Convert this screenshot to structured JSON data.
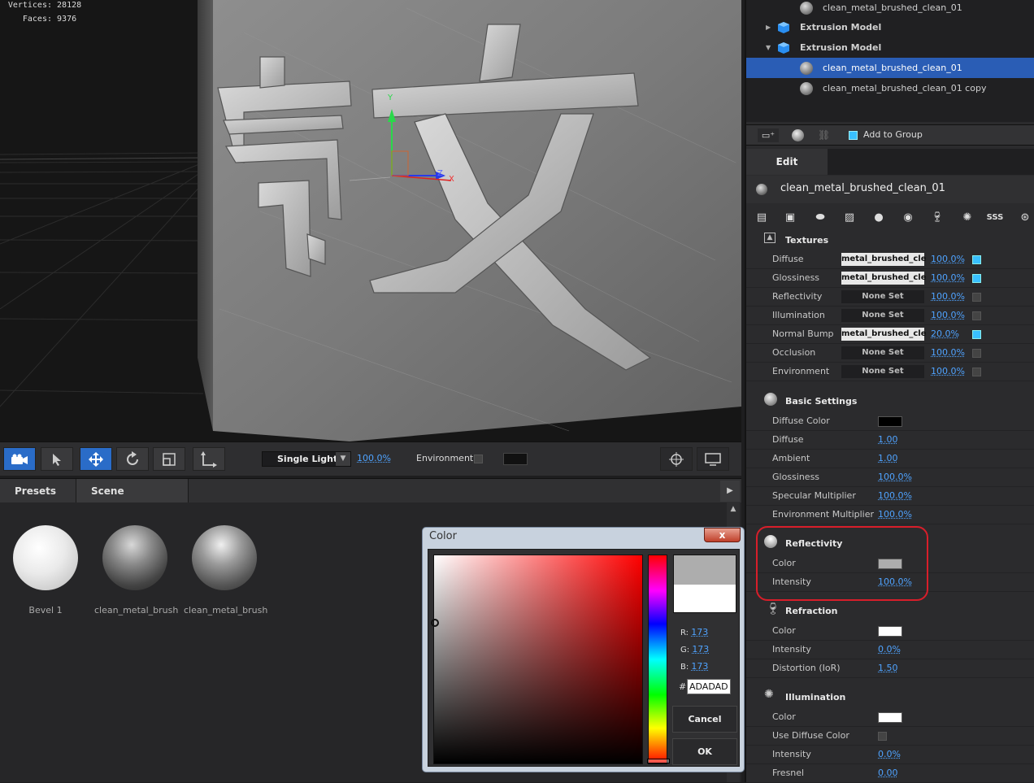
{
  "viewport": {
    "stats": [
      {
        "label": "Vertices:",
        "value": "28128"
      },
      {
        "label": "Faces:",
        "value": "9376"
      }
    ],
    "axis": {
      "y": "Y",
      "z": "Z",
      "x": "X"
    }
  },
  "toolbar": {
    "icons": [
      "camera-icon",
      "pointer-icon",
      "move-icon",
      "rotate-icon",
      "scale-icon",
      "transform-icon"
    ],
    "light_mode": "Single Light",
    "light_pct": "100.0%",
    "environment_label": "Environment"
  },
  "bottom": {
    "tabs": [
      "Presets",
      "Scene Materials"
    ],
    "presets": [
      {
        "label": "Bevel 1"
      },
      {
        "label": "clean_metal_brush"
      },
      {
        "label": "clean_metal_brush"
      }
    ]
  },
  "color_dialog": {
    "title": "Color",
    "close": "x",
    "r_label": "R:",
    "r": "173",
    "g_label": "G:",
    "g": "173",
    "b_label": "B:",
    "b": "173",
    "hash": "#",
    "hex": "ADADAD",
    "cancel": "Cancel",
    "ok": "OK",
    "current_color": "#adadad"
  },
  "tree": [
    {
      "label": "clean_metal_brushed_clean_01",
      "type": "material",
      "selected": false
    },
    {
      "label": "Extrusion Model",
      "type": "model",
      "expanded": false
    },
    {
      "label": "Extrusion Model",
      "type": "model",
      "expanded": true
    },
    {
      "label": "clean_metal_brushed_clean_01",
      "type": "material",
      "selected": true
    },
    {
      "label": "clean_metal_brushed_clean_01 copy",
      "type": "material",
      "selected": false
    }
  ],
  "tree_toolbar": {
    "add_to_group": "Add to Group"
  },
  "edit_tab": "Edit",
  "material_name": "clean_metal_brushed_clean_01",
  "textures": {
    "title": "Textures",
    "rows": [
      {
        "label": "Diffuse",
        "tex": "metal_brushed_cle",
        "set": true,
        "value": "100.0%",
        "on": true
      },
      {
        "label": "Glossiness",
        "tex": "metal_brushed_cle",
        "set": true,
        "value": "100.0%",
        "on": true
      },
      {
        "label": "Reflectivity",
        "tex": "None Set",
        "set": false,
        "value": "100.0%",
        "on": false
      },
      {
        "label": "Illumination",
        "tex": "None Set",
        "set": false,
        "value": "100.0%",
        "on": false
      },
      {
        "label": "Normal Bump",
        "tex": "metal_brushed_cle",
        "set": true,
        "value": "20.0%",
        "on": true
      },
      {
        "label": "Occlusion",
        "tex": "None Set",
        "set": false,
        "value": "100.0%",
        "on": false
      },
      {
        "label": "Environment",
        "tex": "None Set",
        "set": false,
        "value": "100.0%",
        "on": false
      }
    ]
  },
  "basic": {
    "title": "Basic Settings",
    "diffuse_color_label": "Diffuse Color",
    "diffuse_color": "#000000",
    "rows": [
      {
        "label": "Diffuse",
        "value": "1.00"
      },
      {
        "label": "Ambient",
        "value": "1.00"
      },
      {
        "label": "Glossiness",
        "value": "100.0%"
      },
      {
        "label": "Specular Multiplier",
        "value": "100.0%"
      },
      {
        "label": "Environment Multiplier",
        "value": "100.0%"
      }
    ]
  },
  "reflectivity": {
    "title": "Reflectivity",
    "color_label": "Color",
    "color": "#adadad",
    "intensity_label": "Intensity",
    "intensity": "100.0%"
  },
  "refraction": {
    "title": "Refraction",
    "color_label": "Color",
    "color": "#ffffff",
    "intensity_label": "Intensity",
    "intensity": "0.0%",
    "ior_label": "Distortion (IoR)",
    "ior": "1.50"
  },
  "illumination": {
    "title": "Illumination",
    "color_label": "Color",
    "color": "#ffffff",
    "use_diffuse_label": "Use Diffuse Color",
    "intensity_label": "Intensity",
    "intensity": "0.0%",
    "fresnel_label": "Fresnel",
    "fresnel": "0.00"
  },
  "highlight_color": "#d81e2a"
}
